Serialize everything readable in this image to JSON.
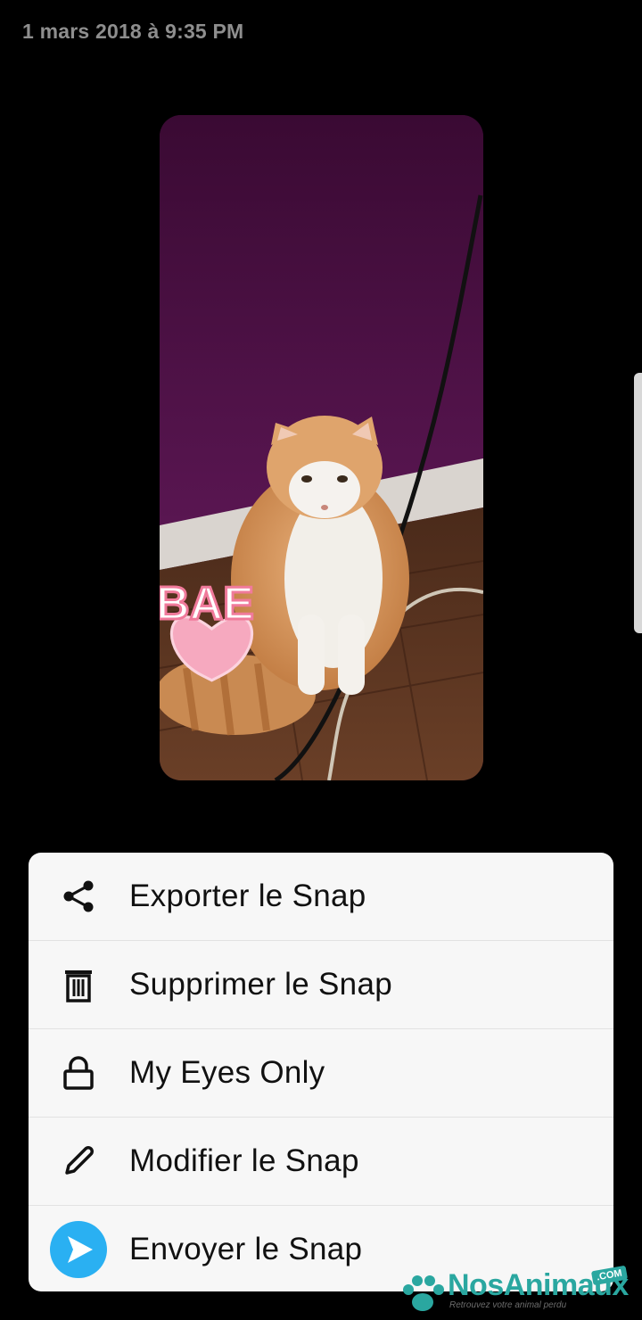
{
  "header": {
    "timestamp": "1 mars 2018 à 9:35 PM"
  },
  "snap": {
    "sticker_text": "BAE",
    "wall_color": "#3c0a35",
    "floor_color": "#5a3320"
  },
  "menu": {
    "items": [
      {
        "label": "Exporter le Snap",
        "icon": "share-icon"
      },
      {
        "label": "Supprimer le Snap",
        "icon": "trash-icon"
      },
      {
        "label": "My Eyes Only",
        "icon": "lock-icon"
      },
      {
        "label": "Modifier le Snap",
        "icon": "pencil-icon"
      },
      {
        "label": "Envoyer le Snap",
        "icon": "send-icon"
      }
    ]
  },
  "watermark": {
    "brand": "NosAnimaux",
    "tagline": "Retrouvez votre animal perdu",
    "tld": ".COM"
  },
  "colors": {
    "background": "#000000",
    "sheet": "#f7f7f7",
    "send_blue": "#2ab0f2",
    "brand_teal": "#2aa7a0"
  }
}
